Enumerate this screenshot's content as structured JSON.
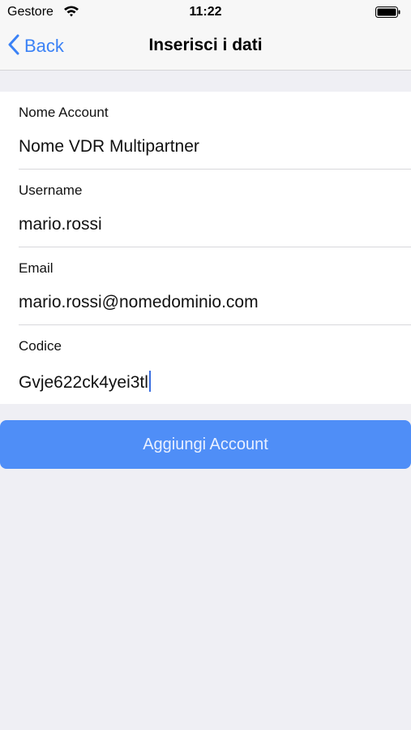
{
  "status_bar": {
    "carrier": "Gestore",
    "time": "11:22"
  },
  "nav": {
    "back_label": "Back",
    "title": "Inserisci i dati"
  },
  "form": {
    "fields": [
      {
        "label": "Nome Account",
        "value": "Nome VDR Multipartner"
      },
      {
        "label": "Username",
        "value": "mario.rossi"
      },
      {
        "label": "Email",
        "value": "mario.rossi@nomedominio.com"
      },
      {
        "label": "Codice",
        "value": "Gvje622ck4yei3tl"
      }
    ]
  },
  "actions": {
    "add_account_label": "Aggiungi Account"
  },
  "colors": {
    "accent": "#3b82f6",
    "button_bg": "#4f8ef7",
    "background": "#efeff4"
  }
}
